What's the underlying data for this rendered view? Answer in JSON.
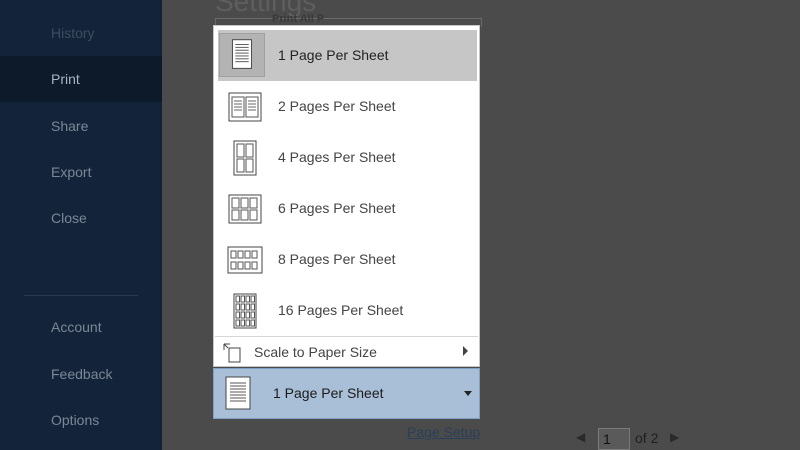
{
  "sidebar": {
    "items": [
      {
        "label": "History",
        "state": "faded"
      },
      {
        "label": "Print",
        "state": "active"
      },
      {
        "label": "Share",
        "state": "normal"
      },
      {
        "label": "Export",
        "state": "normal"
      },
      {
        "label": "Close",
        "state": "normal"
      },
      {
        "label": "Account",
        "state": "normal"
      },
      {
        "label": "Feedback",
        "state": "normal"
      },
      {
        "label": "Options",
        "state": "normal"
      }
    ]
  },
  "main": {
    "title": "Settings",
    "behind_text": "Print All P",
    "page_setup_label": "Page Setup",
    "pager": {
      "current_page": "1",
      "total_label": "of 2"
    }
  },
  "pages_per_sheet_menu": {
    "items": [
      {
        "label": "1 Page Per Sheet",
        "grid": "1x1",
        "selected": true
      },
      {
        "label": "2 Pages Per Sheet",
        "grid": "2x1",
        "selected": false
      },
      {
        "label": "4 Pages Per Sheet",
        "grid": "2x2",
        "selected": false
      },
      {
        "label": "6 Pages Per Sheet",
        "grid": "3x2",
        "selected": false
      },
      {
        "label": "8 Pages Per Sheet",
        "grid": "4x2",
        "selected": false
      },
      {
        "label": "16 Pages Per Sheet",
        "grid": "4x4",
        "selected": false
      }
    ],
    "scale_to_paper_size": {
      "label": "Scale to Paper Size",
      "icon": "scale-page-icon"
    }
  },
  "select": {
    "value": "1 Page Per Sheet",
    "icon": "single-page-icon"
  },
  "colors": {
    "sidebar_bg": "#13243a",
    "sidebar_active_bg": "#0d1a2a",
    "selected_item_bg": "#c6c6c6",
    "select_bg": "#a9bfd8",
    "overlay_bg": "#4b4b4b"
  }
}
